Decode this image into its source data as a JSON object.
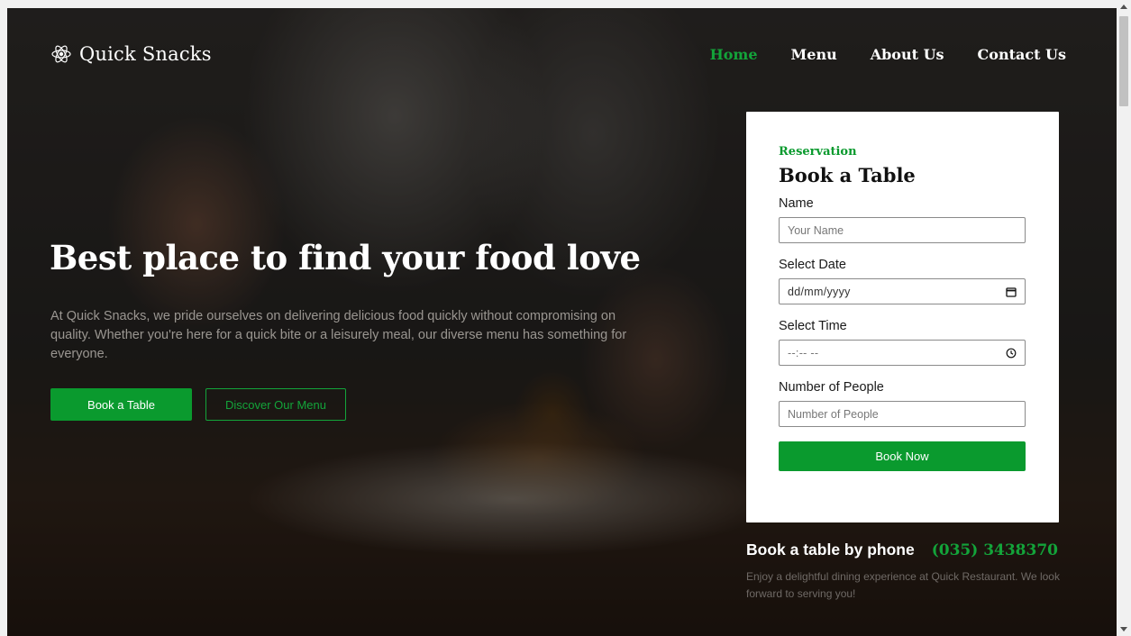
{
  "brand": {
    "name": "Quick Snacks",
    "icon": "atom-icon"
  },
  "nav": {
    "items": [
      {
        "label": "Home",
        "active": true
      },
      {
        "label": "Menu",
        "active": false
      },
      {
        "label": "About Us",
        "active": false
      },
      {
        "label": "Contact Us",
        "active": false
      }
    ]
  },
  "hero": {
    "title": "Best place to find your food love",
    "text": "At Quick Snacks, we pride ourselves on delivering delicious food quickly without compromising on quality. Whether you're here for a quick bite or a leisurely meal, our diverse menu has something for everyone.",
    "primary_button": "Book a Table",
    "secondary_button": "Discover Our Menu"
  },
  "reservation": {
    "eyebrow": "Reservation",
    "title": "Book a Table",
    "name_label": "Name",
    "name_placeholder": "Your Name",
    "date_label": "Select Date",
    "date_placeholder": "dd/mm/yyyy",
    "time_label": "Select Time",
    "time_placeholder": "--:-- --",
    "people_label": "Number of People",
    "people_placeholder": "Number of People",
    "submit_label": "Book Now"
  },
  "phone": {
    "label": "Book a table by phone",
    "number": "(035) 3438370",
    "text": "Enjoy a delightful dining experience at Quick Restaurant. We look forward to serving you!"
  },
  "colors": {
    "accent": "#0a9a2e",
    "accent_text": "#13a43a"
  }
}
